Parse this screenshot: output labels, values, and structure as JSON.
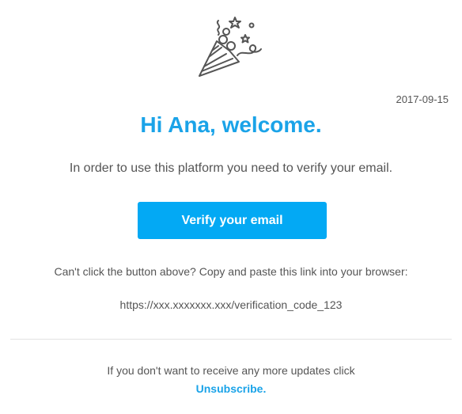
{
  "header": {
    "icon": "party-popper-icon",
    "date": "2017-09-15"
  },
  "main": {
    "greeting": "Hi Ana, welcome.",
    "intro": "In order to use this platform you need to verify your email.",
    "verify_button": "Verify your email",
    "fallback_text": "Can't click the button above? Copy and paste this link into your browser:",
    "verification_link": "https://xxx.xxxxxxx.xxx/verification_code_123"
  },
  "footer": {
    "text": "If you don't want to receive any more updates click",
    "unsubscribe_label": "Unsubscribe."
  },
  "colors": {
    "accent": "#1aa3e8",
    "button": "#03a9f4",
    "text": "#555555",
    "divider": "#e2e2e2"
  }
}
